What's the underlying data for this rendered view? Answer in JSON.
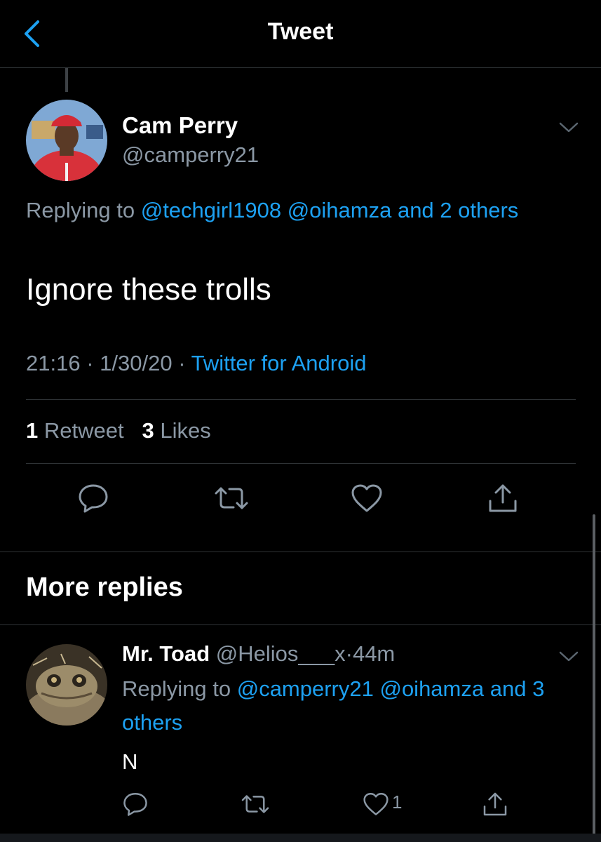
{
  "header": {
    "title": "Tweet",
    "back_icon": "chevron-left-icon"
  },
  "tweet": {
    "author_name": "Cam Perry",
    "author_handle": "@camperry21",
    "replying_prefix": "Replying to",
    "replying_mentions": "@techgirl1908 @oihamza and 2 others",
    "text": "Ignore these trolls",
    "time": "21:16",
    "date": "1/30/20",
    "separator": "·",
    "source": "Twitter for Android",
    "retweets_count": "1",
    "retweets_label": "Retweet",
    "likes_count": "3",
    "likes_label": "Likes"
  },
  "sections": {
    "more_replies": "More replies"
  },
  "reply": {
    "author_name": "Mr. Toad",
    "author_handle": "@Helios___x",
    "separator": "·",
    "age": "44m",
    "replying_prefix": "Replying to",
    "replying_mentions": "@camperry21 @oihamza and 3 others",
    "text": "N",
    "likes_count": "1"
  },
  "colors": {
    "background": "#000000",
    "accent": "#1da1f2",
    "secondary_text": "#8b98a5",
    "divider": "#2f3336"
  },
  "icons": [
    "chevron-left-icon",
    "chevron-down-icon",
    "reply-icon",
    "retweet-icon",
    "heart-icon",
    "share-icon"
  ]
}
